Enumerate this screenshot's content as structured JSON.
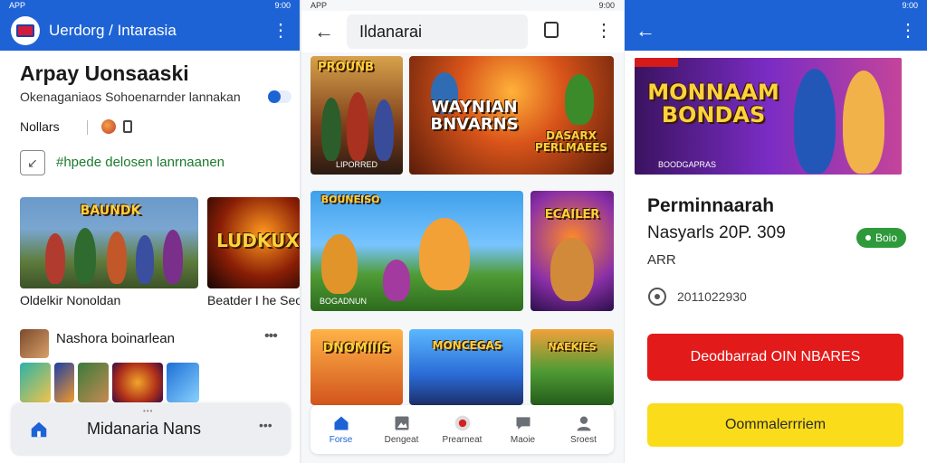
{
  "status_bar": {
    "left": "APP",
    "time": "9:00"
  },
  "phone1": {
    "header_title": "Uerdorg / Intarasia",
    "app_name": "Arpay Uonsaaski",
    "subtitle": "Okenaganiaos Sohoenarnder lannakan",
    "stat_label": "Nollars",
    "feature_text": "#hpede delosen lanrnaanen",
    "cards": [
      {
        "art_text": "BAUNDK",
        "caption": "Oldelkir Nonoldan"
      },
      {
        "art_text": "LUDKUX",
        "caption": "Beatder I he Seoft"
      }
    ],
    "section_title": "Nashora boinarlean",
    "bottom_sheet_label": "Midanaria Nans"
  },
  "phone2": {
    "search_value": "Ildanarai",
    "tiles": [
      {
        "art_text": "PROUNB",
        "caption": "LIPORRED"
      },
      {
        "art_text": "WAYNIAN BNVARNS",
        "caption": "DASARX PERLMAEES"
      },
      {
        "art_text": "BOUNEISO",
        "caption": "BOGADNUN"
      },
      {
        "art_text": "ECAILER",
        "caption": ""
      },
      {
        "art_text": "DNOMIIIS",
        "caption": ""
      },
      {
        "art_text": "MONCEGAS",
        "caption": ""
      },
      {
        "art_text": "NAEKIES",
        "caption": ""
      }
    ],
    "nav": [
      {
        "label": "Forse",
        "icon": "home-icon"
      },
      {
        "label": "Dengeat",
        "icon": "gallery-icon"
      },
      {
        "label": "Prearneat",
        "icon": "record-icon"
      },
      {
        "label": "Maoie",
        "icon": "chat-icon"
      },
      {
        "label": "Sroest",
        "icon": "profile-icon"
      }
    ]
  },
  "phone3": {
    "banner_text": "MONNAAM BONDAS",
    "banner_caption": "BOODGAPRAS",
    "title": "Perminnaarah",
    "price_line": "Nasyarls 20P. 309",
    "sub_line": "ARR",
    "badge": "Boio",
    "info_value": "2011022930",
    "primary_button": "Deodbarrad OIN NBARES",
    "secondary_button": "Oommalerrriem"
  },
  "colors": {
    "brand_blue": "#1e63d6",
    "primary_red": "#e31a1a",
    "secondary_yellow": "#fbdc1a",
    "badge_green": "#2f9a3b"
  }
}
